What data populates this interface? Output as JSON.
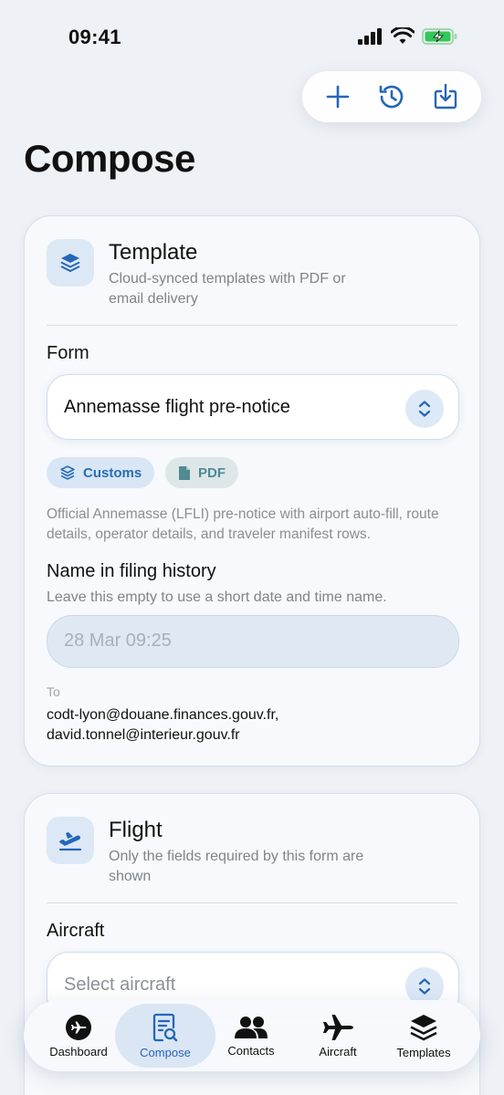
{
  "status_bar": {
    "time": "09:41"
  },
  "page": {
    "title": "Compose"
  },
  "template_card": {
    "title": "Template",
    "subtitle": "Cloud-synced templates with PDF or email delivery",
    "form_label": "Form",
    "form_value": "Annemasse flight pre-notice",
    "chips": [
      {
        "label": "Customs",
        "icon": "stack-icon"
      },
      {
        "label": "PDF",
        "icon": "document-icon"
      }
    ],
    "description": "Official Annemasse (LFLI) pre-notice with airport auto-fill, route details, operator details, and traveler manifest rows.",
    "name_label": "Name in filing history",
    "name_hint": "Leave this empty to use a short date and time name.",
    "name_placeholder": "28 Mar 09:25",
    "to_label": "To",
    "to_line1": "codt-lyon@douane.finances.gouv.fr,",
    "to_line2": "david.tonnel@interieur.gouv.fr"
  },
  "flight_card": {
    "title": "Flight",
    "subtitle": "Only the fields required by this form are shown",
    "aircraft_label": "Aircraft",
    "aircraft_placeholder": "Select aircraft"
  },
  "tabs": [
    {
      "label": "Dashboard",
      "icon": "plane-circle-icon",
      "active": false
    },
    {
      "label": "Compose",
      "icon": "compose-document-icon",
      "active": true
    },
    {
      "label": "Contacts",
      "icon": "people-icon",
      "active": false
    },
    {
      "label": "Aircraft",
      "icon": "airplane-icon",
      "active": false
    },
    {
      "label": "Templates",
      "icon": "stack-icon",
      "active": false
    }
  ],
  "colors": {
    "accent": "#2467b8",
    "background": "#eef1f6",
    "card": "#f7f9fc",
    "battery": "#34c759"
  }
}
